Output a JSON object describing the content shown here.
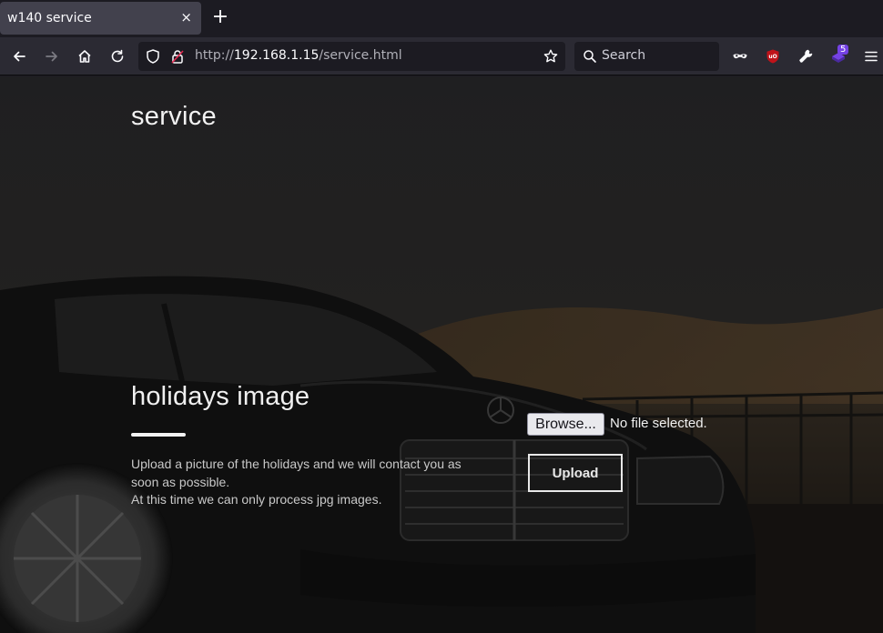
{
  "browser": {
    "tab_title": "w140 service",
    "tab_close_glyph": "×",
    "new_tab_glyph": "+",
    "url_prefix": "http://",
    "url_host": "192.168.1.15",
    "url_path": "/service.html",
    "search_placeholder": "Search",
    "extension_badge": "5",
    "icons": [
      "back-icon",
      "forward-icon",
      "home-icon",
      "reload-icon",
      "shield-icon",
      "lock-icon",
      "star-icon",
      "search-icon",
      "mask-icon",
      "ublock-icon",
      "wrench-icon",
      "extension-icon",
      "menu-icon"
    ]
  },
  "page": {
    "site_title": "service",
    "section_title": "holidays image",
    "description_line1": "Upload a picture of the holidays and we will contact you as soon as possible.",
    "description_line2": "At this time we can only process jpg images.",
    "browse_label": "Browse...",
    "file_status": "No file selected.",
    "upload_label": "Upload"
  },
  "colors": {
    "chrome_bg": "#1c1b22",
    "toolbar_bg": "#2b2a33",
    "tab_active": "#42414d",
    "badge": "#7542e5"
  }
}
